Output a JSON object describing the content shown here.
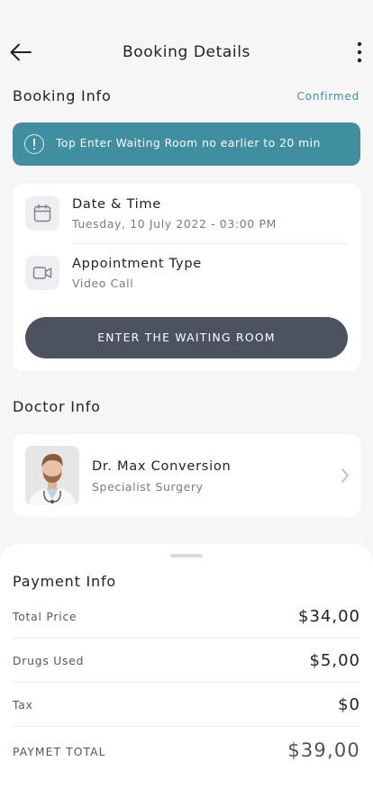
{
  "header": {
    "title": "Booking Details",
    "back_icon": "arrow-left-icon",
    "more_icon": "more-vertical-icon"
  },
  "booking_info": {
    "title": "Booking Info",
    "status": "Confirmed",
    "alert": {
      "icon": "alert-circle-icon",
      "text": "Top Enter Waiting Room no earlier to 20 min"
    },
    "date_time": {
      "icon": "calendar-icon",
      "label": "Date & Time",
      "value": "Tuesday, 10 July 2022 - 03:00 PM"
    },
    "appointment_type": {
      "icon": "video-camera-icon",
      "label": "Appointment Type",
      "value": "Video Call"
    },
    "enter_button": "ENTER THE WAITING ROOM"
  },
  "doctor_info": {
    "title": "Doctor Info",
    "name": "Dr. Max Conversion",
    "specialty": "Specialist Surgery",
    "chevron_icon": "chevron-right-icon"
  },
  "payment_info": {
    "title": "Payment Info",
    "rows": [
      {
        "label": "Total Price",
        "amount": "$34,00"
      },
      {
        "label": "Drugs Used",
        "amount": "$5,00"
      },
      {
        "label": "Tax",
        "amount": "$0"
      }
    ],
    "total": {
      "label": "PAYMET TOTAL",
      "amount": "$39,00"
    }
  },
  "colors": {
    "accent": "#3f8fa1",
    "button": "#4c5260",
    "background": "#f6f6f7",
    "card": "#ffffff"
  }
}
